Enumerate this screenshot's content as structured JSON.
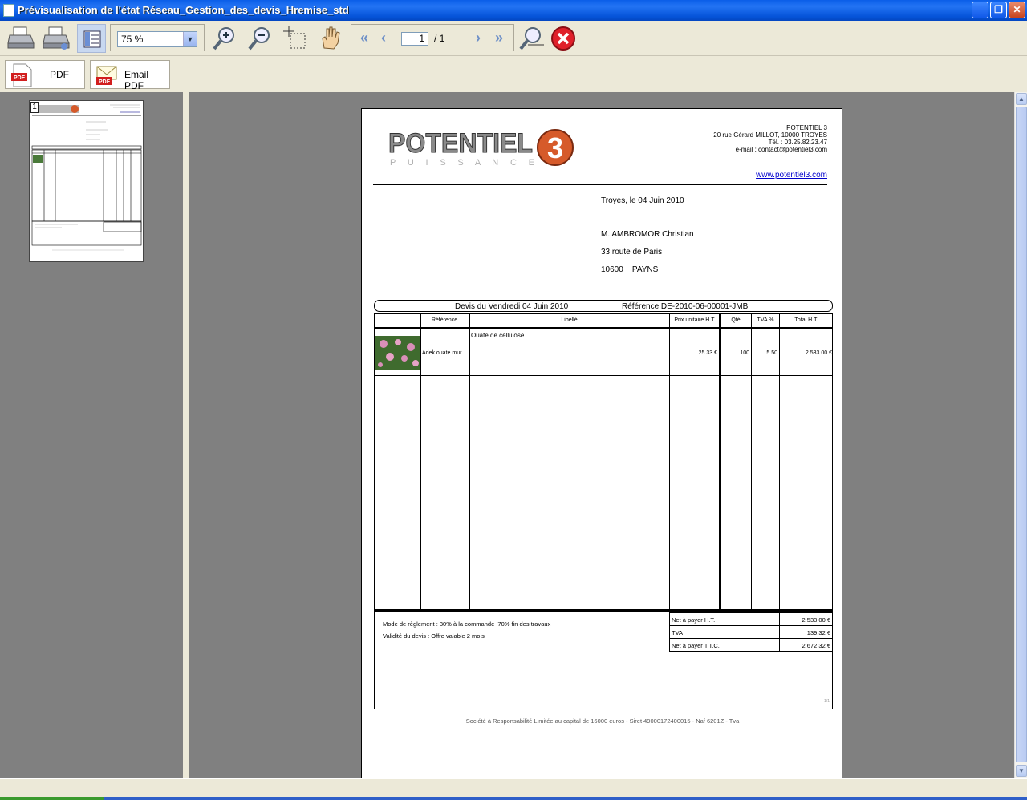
{
  "window": {
    "title": "Prévisualisation de l'état Réseau_Gestion_des_devis_Hremise_std"
  },
  "toolbar": {
    "zoom_value": "75 %",
    "page_current": "1",
    "page_total": "/ 1"
  },
  "export": {
    "pdf_label": "PDF",
    "email_pdf_label": "Email PDF"
  },
  "thumbnail": {
    "page_number": "1"
  },
  "document": {
    "company": {
      "name": "POTENTIEL 3",
      "address": "20 rue Gérard MILLOT, 10000 TROYES",
      "phone": "Tél. : 03.25.82.23.47",
      "email": "e-mail : contact@potentiel3.com",
      "website": "www.potentiel3.com",
      "logo_main": "POTENTIEL",
      "logo_number": "3",
      "logo_sub": "P U I S S A N C E"
    },
    "date_line": "Troyes, le 04 Juin 2010",
    "client": {
      "name": "M. AMBROMOR Christian",
      "street": "33 route de Paris",
      "city": "10600    PAYNS"
    },
    "quote_title": "Devis du Vendredi 04 Juin 2010",
    "quote_ref": "Référence DE-2010-06-00001-JMB",
    "columns": [
      "Référence",
      "Libellé",
      "Prix unitaire H.T.",
      "Qté",
      "TVA %",
      "Total H.T."
    ],
    "line": {
      "reference": "Adek ouate mur",
      "label": "Ouate de cellulose",
      "unit_price": "25.33 €",
      "qty": "100",
      "vat": "5.50",
      "total": "2 533.00 €"
    },
    "terms": {
      "payment": "Mode de règlement : 30% à la commande ,70% fin des travaux",
      "validity": "Validité du devis  : Offre valable 2 mois"
    },
    "totals": [
      {
        "label": "Net à payer H.T.",
        "value": "2 533.00 €"
      },
      {
        "label": "TVA",
        "value": "139.32 €"
      },
      {
        "label": "Net à payer T.T.C.",
        "value": "2 672.32 €"
      }
    ],
    "page_marker": "1/1",
    "legal": "Société à Responsabilité Limitée au capital de 16000 euros  -  Siret 49000172400015  -  Naf 6201Z  -  Tva"
  }
}
